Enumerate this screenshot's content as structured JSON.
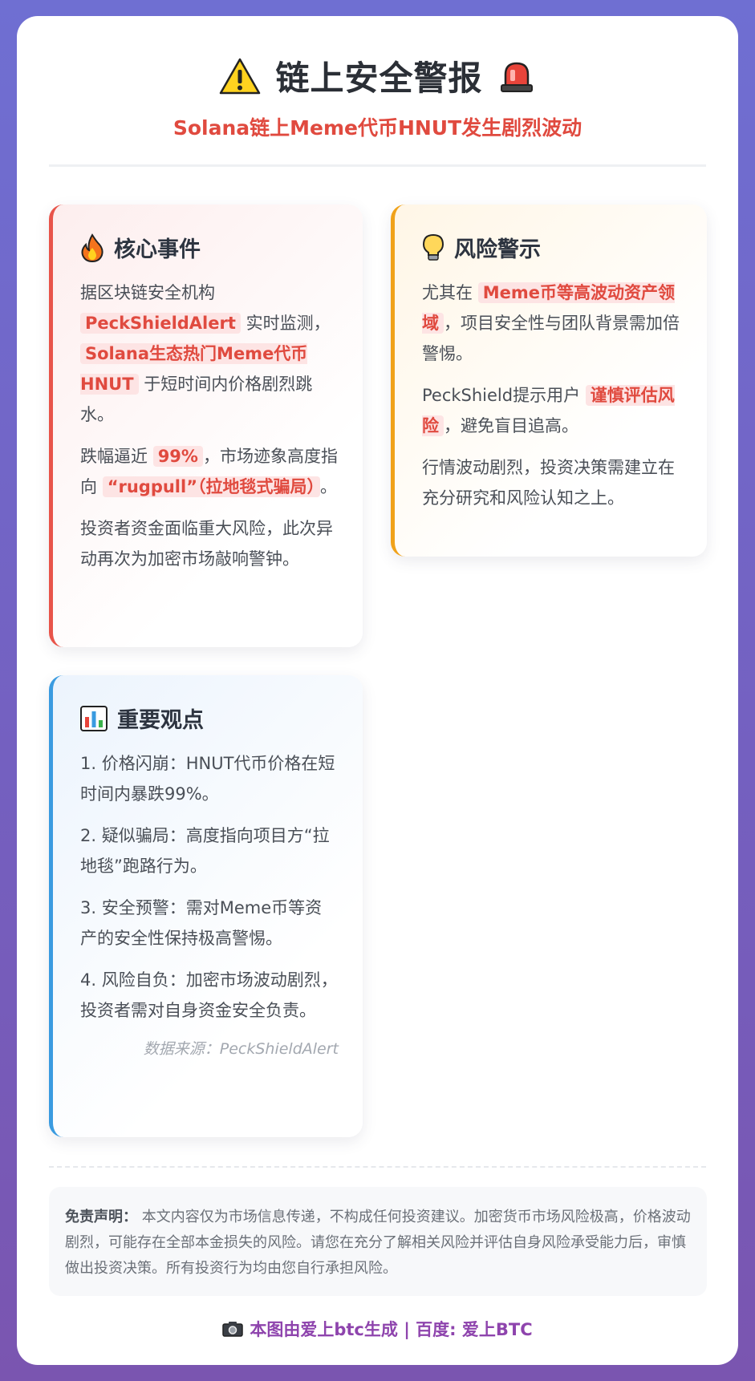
{
  "header": {
    "title": "链上安全警报",
    "left_icon": "warning-icon",
    "right_icon": "siren-icon",
    "subtitle": "Solana链上Meme代币HNUT发生剧烈波动"
  },
  "core": {
    "icon": "fire-icon",
    "title": "核心事件",
    "p1_a": "据区块链安全机构",
    "p1_hl1": "PeckShieldAlert",
    "p1_b": "实时监测，",
    "p1_hl2": "Solana生态热门Meme代币HNUT",
    "p1_c": "于短时间内价格剧烈跳水。",
    "p2_a": "跌幅逼近",
    "p2_hl1": "99%",
    "p2_b": "，市场迹象高度指向",
    "p2_hl2": "“rugpull”（拉地毯式骗局）",
    "p2_c": "。",
    "p3": "投资者资金面临重大风险，此次异动再次为加密市场敲响警钟。"
  },
  "risk": {
    "icon": "lightbulb-icon",
    "title": "风险警示",
    "p1_a": "尤其在",
    "p1_hl": "Meme币等高波动资产领域",
    "p1_b": "，项目安全性与团队背景需加倍警惕。",
    "p2_a": "PeckShield提示用户",
    "p2_hl": "谨慎评估风险",
    "p2_b": "，避免盲目追高。",
    "p3": "行情波动剧烈，投资决策需建立在充分研究和风险认知之上。"
  },
  "views": {
    "icon": "bar-chart-icon",
    "title": "重要观点",
    "items": [
      "1. 价格闪崩：HNUT代币价格在短时间内暴跌99%。",
      "2. 疑似骗局：高度指向项目方“拉地毯”跑路行为。",
      "3. 安全预警：需对Meme币等资产的安全性保持极高警惕。",
      "4. 风险自负：加密市场波动剧烈，投资者需对自身资金安全负责。"
    ],
    "source": "数据来源：PeckShieldAlert"
  },
  "disclaimer": {
    "label": "免责声明：",
    "text": "本文内容仅为市场信息传递，不构成任何投资建议。加密货币市场风险极高，价格波动剧烈，可能存在全部本金损失的风险。请您在充分了解相关风险并评估自身风险承受能力后，审慎做出投资决策。所有投资行为均由您自行承担风险。"
  },
  "footer": {
    "icon": "camera-icon",
    "text": "本图由爱上btc生成 | 百度: 爱上BTC"
  },
  "colors": {
    "accent_red": "#e04a3f",
    "accent_orange": "#f0a21a",
    "accent_blue": "#3a9be0",
    "footer_purple": "#8e44ad"
  }
}
